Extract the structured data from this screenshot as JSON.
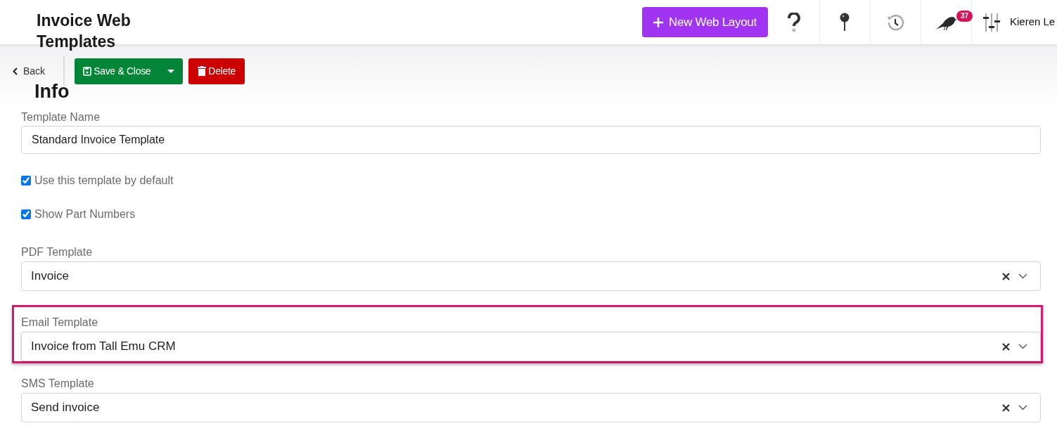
{
  "header": {
    "title": "Invoice Web Templates",
    "new_button": "New Web Layout",
    "notifications_count": "37",
    "user_name": "Kieren Le"
  },
  "toolbar": {
    "back": "Back",
    "save": "Save & Close",
    "delete": "Delete"
  },
  "section_title": "Info",
  "fields": [
    {
      "kind": "text",
      "label": "Template Name",
      "value": "Standard Invoice Template",
      "highlighted": false
    },
    {
      "kind": "checkbox",
      "label": "Use this template by default",
      "checked": true
    },
    {
      "kind": "checkbox",
      "label": "Show Part Numbers",
      "checked": true
    },
    {
      "kind": "select",
      "label": "PDF Template",
      "value": "Invoice",
      "highlighted": false
    },
    {
      "kind": "select",
      "label": "Email Template",
      "value": "Invoice from Tall Emu CRM",
      "highlighted": true
    },
    {
      "kind": "select",
      "label": "SMS Template",
      "value": "Send invoice",
      "highlighted": false
    }
  ]
}
